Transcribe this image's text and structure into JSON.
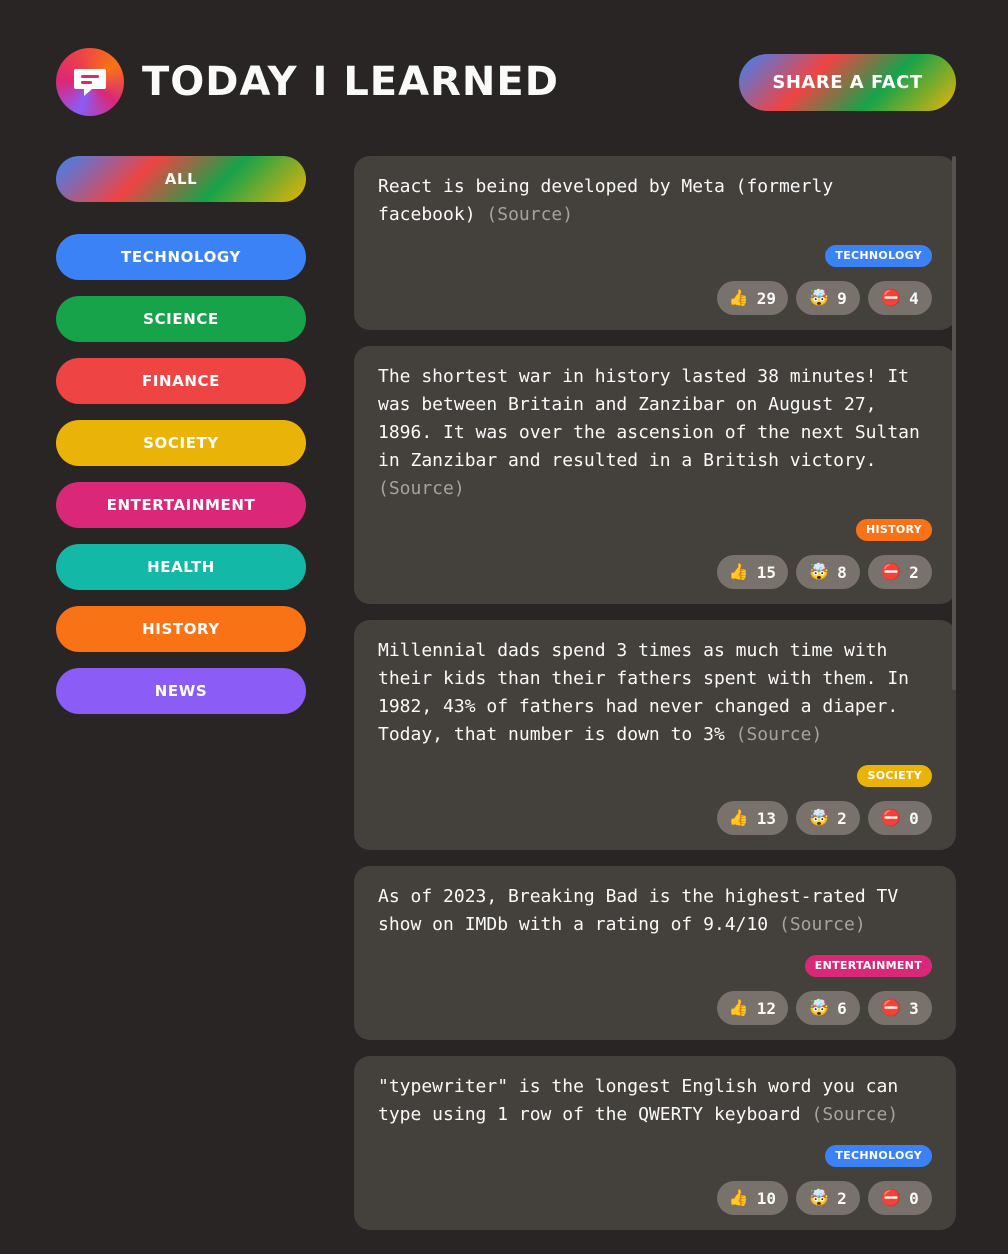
{
  "header": {
    "title": "Today I Learned",
    "share_button": "Share a fact"
  },
  "sidebar": {
    "all_label": "All",
    "categories": [
      {
        "label": "Technology",
        "color": "#3b82f6"
      },
      {
        "label": "Science",
        "color": "#16a34a"
      },
      {
        "label": "Finance",
        "color": "#ef4444"
      },
      {
        "label": "Society",
        "color": "#eab308"
      },
      {
        "label": "Entertainment",
        "color": "#db2777"
      },
      {
        "label": "Health",
        "color": "#14b8a6"
      },
      {
        "label": "History",
        "color": "#f97316"
      },
      {
        "label": "News",
        "color": "#8b5cf6"
      }
    ]
  },
  "facts": [
    {
      "text": "React is being developed by Meta (formerly facebook)",
      "source": "(Source)",
      "category": "Technology",
      "category_color": "#3b82f6",
      "votes_interesting": "29",
      "votes_mindblowing": "9",
      "votes_false": "4"
    },
    {
      "text": "The shortest war in history lasted 38 minutes! It was between Britain and Zanzibar on August 27, 1896. It was over the ascension of the next Sultan in Zanzibar and resulted in a British victory.",
      "source": "(Source)",
      "category": "History",
      "category_color": "#f97316",
      "votes_interesting": "15",
      "votes_mindblowing": "8",
      "votes_false": "2"
    },
    {
      "text": "Millennial dads spend 3 times as much time with their kids than their fathers spent with them. In 1982, 43% of fathers had never changed a diaper. Today, that number is down to 3%",
      "source": "(Source)",
      "category": "Society",
      "category_color": "#eab308",
      "votes_interesting": "13",
      "votes_mindblowing": "2",
      "votes_false": "0"
    },
    {
      "text": "As of 2023, Breaking Bad is the highest-rated TV show on IMDb with a rating of 9.4/10",
      "source": "(Source)",
      "category": "Entertainment",
      "category_color": "#db2777",
      "votes_interesting": "12",
      "votes_mindblowing": "6",
      "votes_false": "3"
    },
    {
      "text": "\"typewriter\" is the longest English word you can type using 1 row of the QWERTY keyboard",
      "source": "(Source)",
      "category": "Technology",
      "category_color": "#3b82f6",
      "votes_interesting": "10",
      "votes_mindblowing": "2",
      "votes_false": "0"
    }
  ],
  "icons": {
    "logo": "speech-bubble-icon",
    "interesting": "👍",
    "mindblowing": "🤯",
    "false": "⛔"
  }
}
